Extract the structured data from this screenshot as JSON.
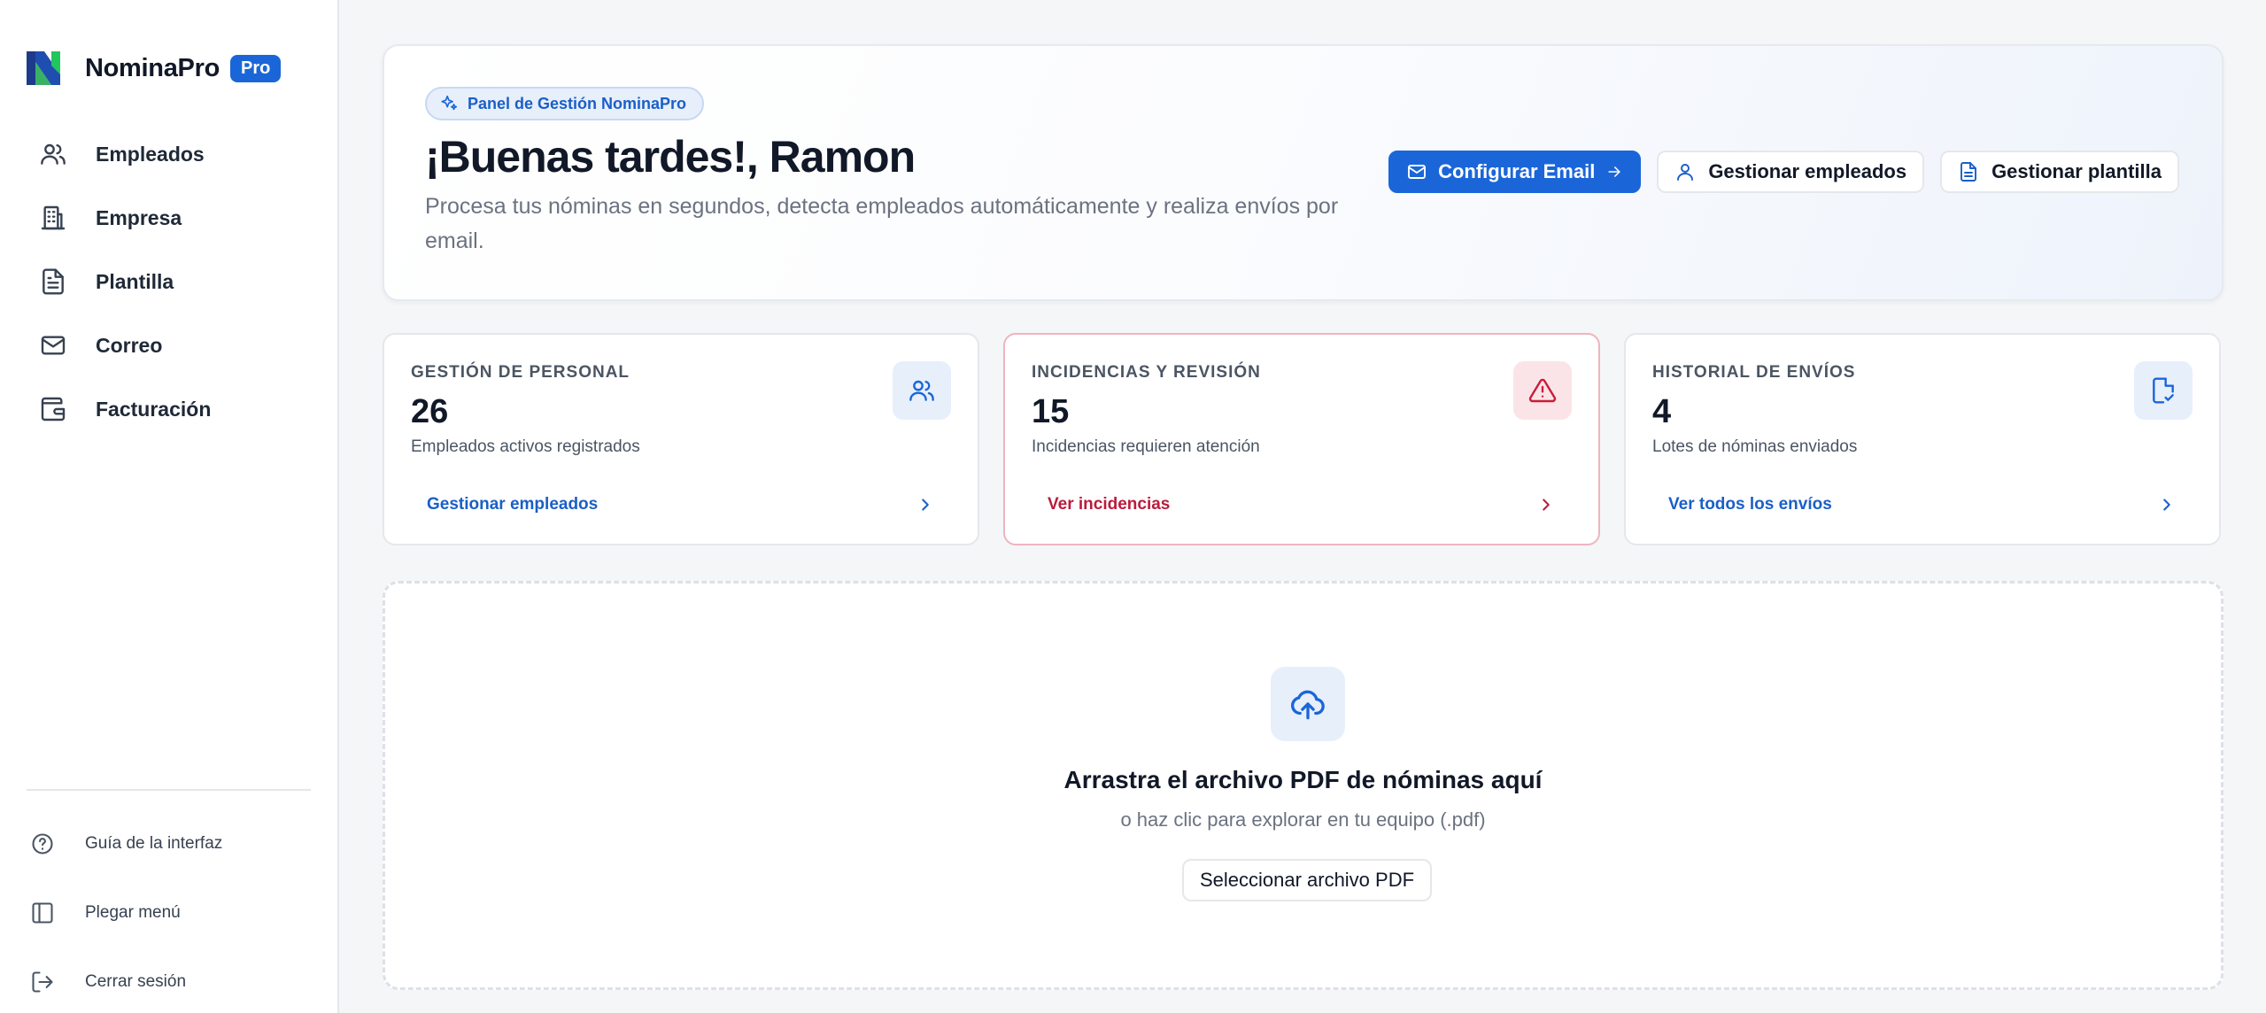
{
  "brand": {
    "name": "NominaPro",
    "badge": "Pro",
    "colors": {
      "accent": "#1a66d9",
      "logo_dark": "#1e3a8a",
      "logo_green": "#22c55e",
      "danger": "#c81e3a"
    }
  },
  "sidebar": {
    "items": [
      {
        "label": "Empleados",
        "icon": "users-icon"
      },
      {
        "label": "Empresa",
        "icon": "building-icon"
      },
      {
        "label": "Plantilla",
        "icon": "file-text-icon"
      },
      {
        "label": "Correo",
        "icon": "mail-icon"
      },
      {
        "label": "Facturación",
        "icon": "wallet-icon"
      }
    ],
    "bottom": [
      {
        "label": "Guía de la interfaz",
        "icon": "help-circle-icon"
      },
      {
        "label": "Plegar menú",
        "icon": "panel-left-icon"
      },
      {
        "label": "Cerrar sesión",
        "icon": "log-out-icon"
      }
    ]
  },
  "hero": {
    "chip": "Panel de Gestión NominaPro",
    "title": "¡Buenas tardes!, Ramon",
    "subtitle": "Procesa tus nóminas en segundos, detecta empleados automáticamente y realiza envíos por email.",
    "actions": {
      "email": "Configurar Email",
      "employees": "Gestionar empleados",
      "template": "Gestionar plantilla"
    }
  },
  "cards": [
    {
      "label": "GESTIÓN DE PERSONAL",
      "value": "26",
      "desc": "Empleados activos registrados",
      "link": "Gestionar empleados",
      "icon": "users-icon"
    },
    {
      "label": "INCIDENCIAS Y REVISIÓN",
      "value": "15",
      "desc": "Incidencias requieren atención",
      "link": "Ver incidencias",
      "icon": "alert-triangle-icon"
    },
    {
      "label": "HISTORIAL DE ENVÍOS",
      "value": "4",
      "desc": "Lotes de nóminas enviados",
      "link": "Ver todos los envíos",
      "icon": "file-check-icon"
    }
  ],
  "dropzone": {
    "title": "Arrastra el archivo PDF de nóminas aquí",
    "subtitle": "o haz clic para explorar en tu equipo (.pdf)",
    "button": "Seleccionar archivo PDF",
    "icon": "cloud-upload-icon"
  }
}
